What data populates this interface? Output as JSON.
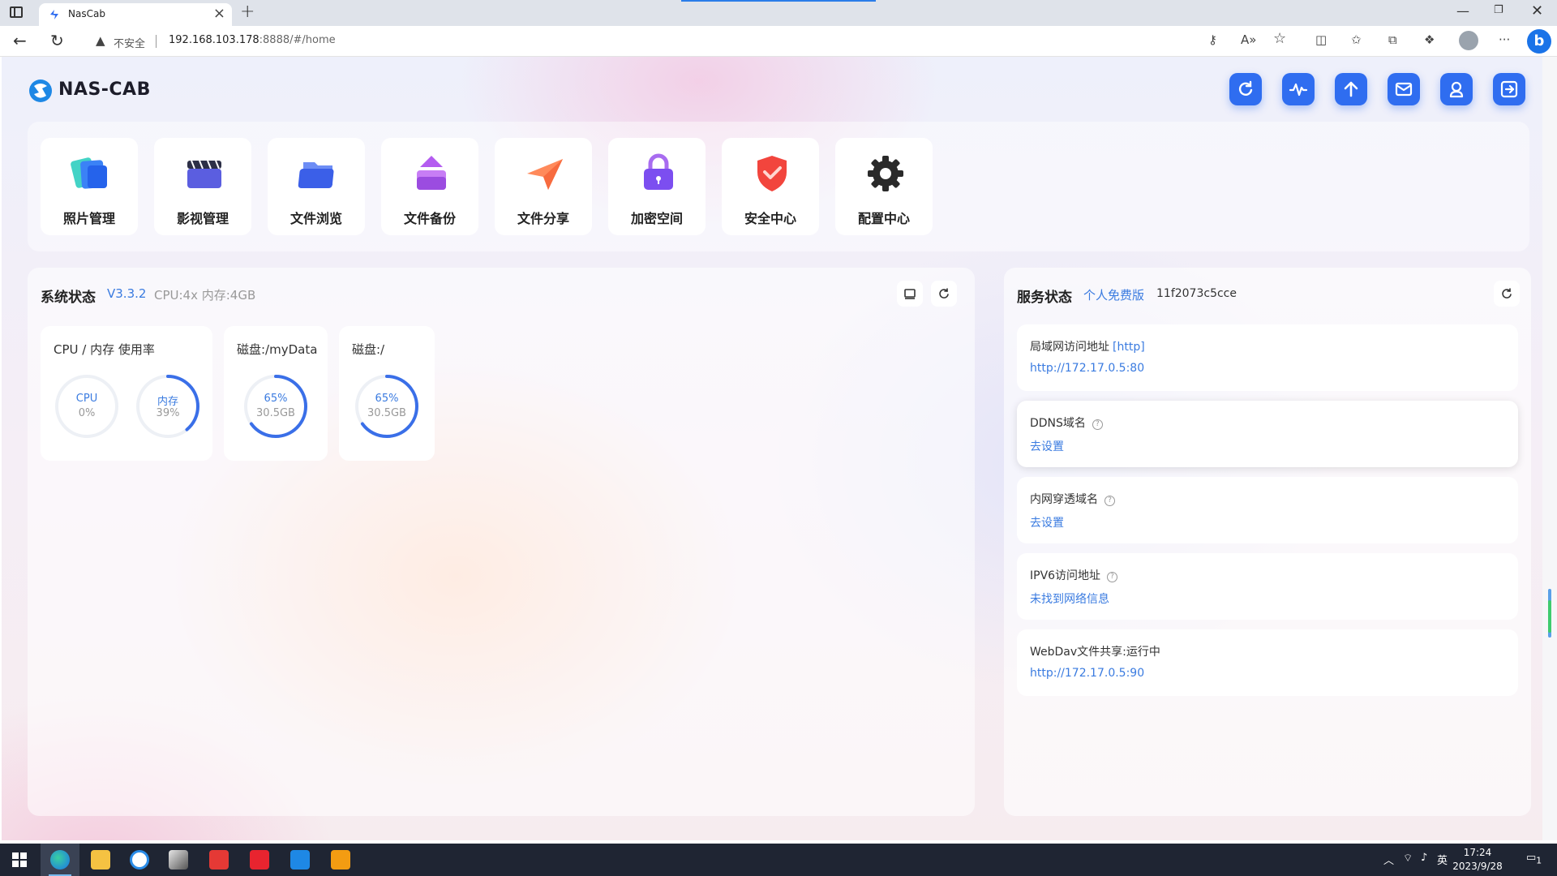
{
  "browser": {
    "tab_title": "NasCab",
    "insecure_label": "不安全",
    "url_host": "192.168.103.178",
    "url_rest": ":8888/#/home"
  },
  "app": {
    "logo_text": "NAS-CAB",
    "toolbar_icons": [
      "refresh-icon",
      "activity-icon",
      "upload-icon",
      "mail-icon",
      "user-icon",
      "logout-icon"
    ],
    "accent_color": "#2f6df0"
  },
  "apps": [
    {
      "label": "照片管理",
      "icon": "photos-icon"
    },
    {
      "label": "影视管理",
      "icon": "video-icon"
    },
    {
      "label": "文件浏览",
      "icon": "folder-icon"
    },
    {
      "label": "文件备份",
      "icon": "backup-icon"
    },
    {
      "label": "文件分享",
      "icon": "share-icon"
    },
    {
      "label": "加密空间",
      "icon": "lock-icon"
    },
    {
      "label": "安全中心",
      "icon": "shield-icon"
    },
    {
      "label": "配置中心",
      "icon": "gear-icon"
    }
  ],
  "system": {
    "title": "系统状态",
    "version": "V3.3.2",
    "specs": "CPU:4x 内存:4GB",
    "cards": [
      {
        "title": "CPU / 内存 使用率",
        "gauges": [
          {
            "label": "CPU",
            "value": "0%",
            "percent": 0
          },
          {
            "label": "内存",
            "value": "39%",
            "percent": 39
          }
        ]
      },
      {
        "title": "磁盘:/myData",
        "gauges": [
          {
            "label": "65%",
            "value": "30.5GB",
            "percent": 65
          }
        ]
      },
      {
        "title": "磁盘:/",
        "gauges": [
          {
            "label": "65%",
            "value": "30.5GB",
            "percent": 65
          }
        ]
      }
    ]
  },
  "services": {
    "title": "服务状态",
    "edition": "个人免费版",
    "id": "11f2073c5cce",
    "items": [
      {
        "label": "局域网访问地址",
        "tag": "[http]",
        "value": "http://172.17.0.5:80",
        "help": false
      },
      {
        "label": "DDNS域名",
        "tag": "",
        "value": "去设置",
        "help": true
      },
      {
        "label": "内网穿透域名",
        "tag": "",
        "value": "去设置",
        "help": true
      },
      {
        "label": "IPV6访问地址",
        "tag": "",
        "value": "未找到网络信息",
        "help": true
      },
      {
        "label": "WebDav文件共享:运行中",
        "tag": "",
        "value": "http://172.17.0.5:90",
        "help": false
      }
    ]
  },
  "taskbar": {
    "ime": "英",
    "time": "17:24",
    "date": "2023/9/28",
    "notification_count": "1"
  }
}
